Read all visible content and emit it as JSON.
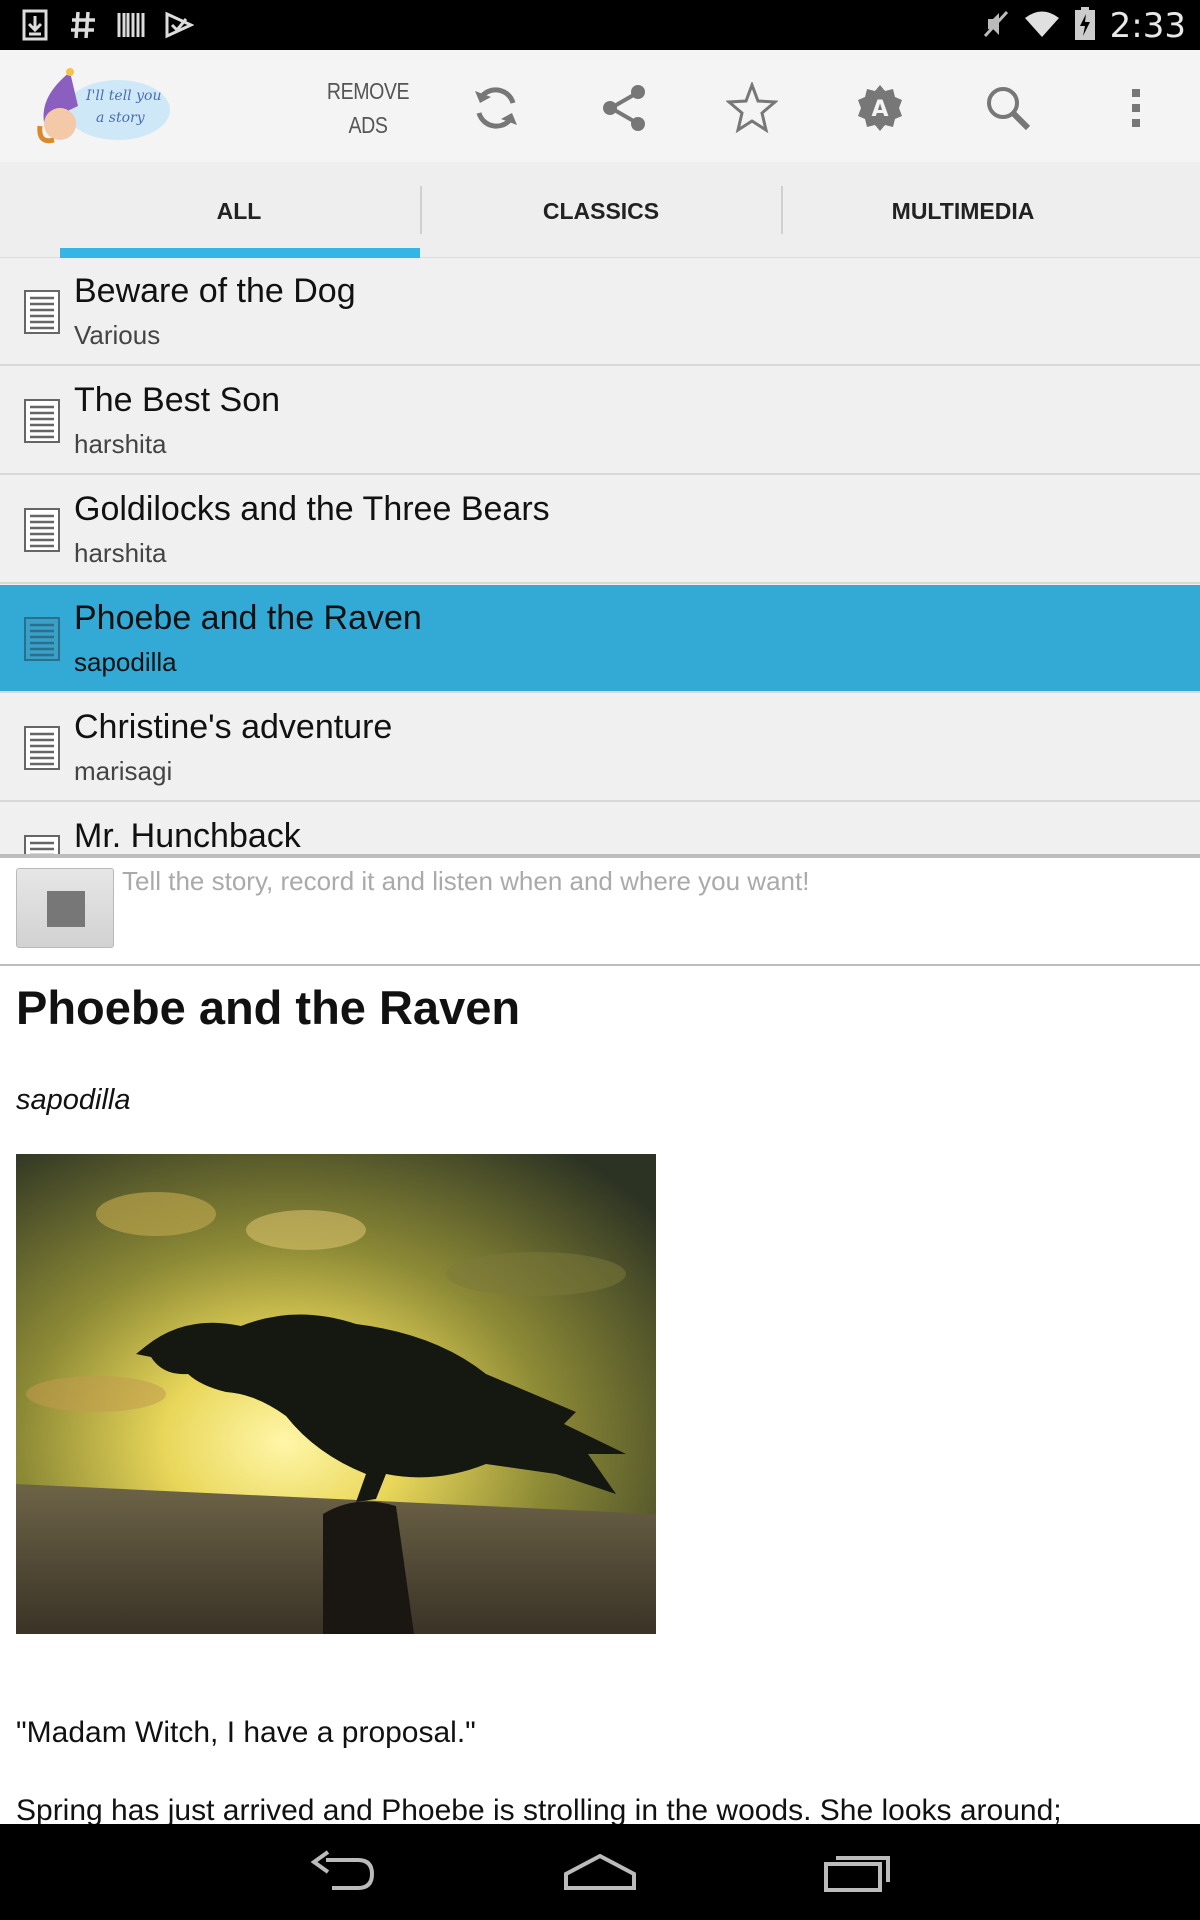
{
  "status_bar": {
    "time": "2:33",
    "left_icons": [
      "download-icon",
      "hashtag-icon",
      "barcode-icon",
      "checkmark-icon"
    ],
    "right_icons": [
      "mute-icon",
      "wifi-icon",
      "battery-charging-icon"
    ]
  },
  "action_bar": {
    "logo_text": "I'll tell you a story",
    "remove_ads_line1": "REMOVE",
    "remove_ads_line2": "ADS",
    "icons": [
      "refresh-icon",
      "share-icon",
      "star-icon",
      "badge-a-icon",
      "search-icon",
      "overflow-menu-icon"
    ]
  },
  "tabs": [
    {
      "label": "ALL",
      "selected": true
    },
    {
      "label": "CLASSICS",
      "selected": false
    },
    {
      "label": "MULTIMEDIA",
      "selected": false
    }
  ],
  "stories": [
    {
      "title": "Beware of the Dog",
      "author": "Various",
      "selected": false
    },
    {
      "title": "The Best Son",
      "author": "harshita",
      "selected": false
    },
    {
      "title": "Goldilocks and the Three Bears",
      "author": "harshita",
      "selected": false
    },
    {
      "title": "Phoebe and the Raven",
      "author": "sapodilla",
      "selected": true
    },
    {
      "title": "Christine's adventure",
      "author": "marisagi",
      "selected": false
    },
    {
      "title": "Mr. Hunchback",
      "author": "",
      "selected": false
    }
  ],
  "recorder": {
    "hint": "Tell the story, record it and listen when and where you want!"
  },
  "content": {
    "title": "Phoebe and the Raven",
    "author": "sapodilla",
    "paragraph1": "\"Madam Witch, I have a proposal.\"",
    "paragraph2": "Spring has just arrived and Phoebe is strolling in the woods. She looks around;"
  },
  "colors": {
    "accent": "#33b5e5",
    "selected_row": "#33a9d6",
    "status_bar": "#000000",
    "action_bar": "#f4f4f4"
  }
}
